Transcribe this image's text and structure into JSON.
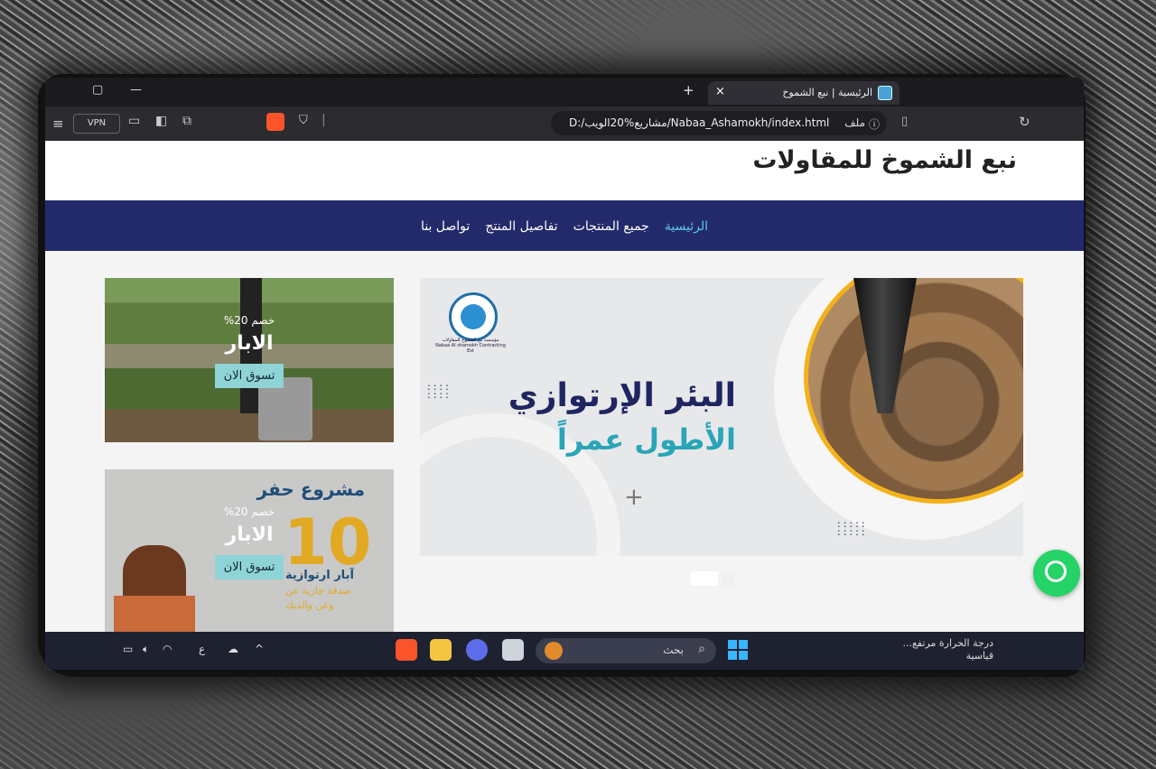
{
  "browser": {
    "tab_title": "الرئيسية | نبع الشموخ",
    "tab_close": "×",
    "new_tab": "+",
    "window_min": "—",
    "window_restore": "▢",
    "url": "D:/مشاريع%20الويب/Nabaa_Ashamokh/index.html",
    "file_label": "ملف",
    "vpn_label": "VPN"
  },
  "site": {
    "brand": "نبع الشموخ للمقاولات",
    "nav": [
      {
        "label": "الرئيسية",
        "active": true
      },
      {
        "label": "جميع المنتجات",
        "active": false
      },
      {
        "label": "تفاصيل المنتج",
        "active": false
      },
      {
        "label": "تواصل بنا",
        "active": false
      }
    ],
    "banner": {
      "title_line1": "البئر الإرتوازي",
      "title_line2": "الأطول عمراً",
      "logo_text": "مؤسسة نبع الشموخ للمقاولات",
      "logo_subtext": "Nabaa Al shamokh Contracting Est"
    },
    "cards": [
      {
        "discount": "خصم 20%",
        "title": "الابار",
        "button": "تسوق الان"
      },
      {
        "discount": "خصم 20%",
        "title": "الابار",
        "button": "تسوق الان",
        "poster_title": "مشروع حفر",
        "poster_number": "10",
        "poster_line1": "آبار ارتوازية",
        "poster_line2": "صدقة جارية عن",
        "poster_line3": "وعن والديك"
      }
    ]
  },
  "taskbar": {
    "search_placeholder": "بحث",
    "weather_line1": "درجة الحرارة مرتفع...",
    "weather_line2": "قياسية",
    "lang": "ع"
  },
  "colors": {
    "nav_bg": "#232a6b",
    "nav_active": "#5bc8e8",
    "shop_button": "#8ed3d6",
    "whatsapp": "#25d366"
  }
}
